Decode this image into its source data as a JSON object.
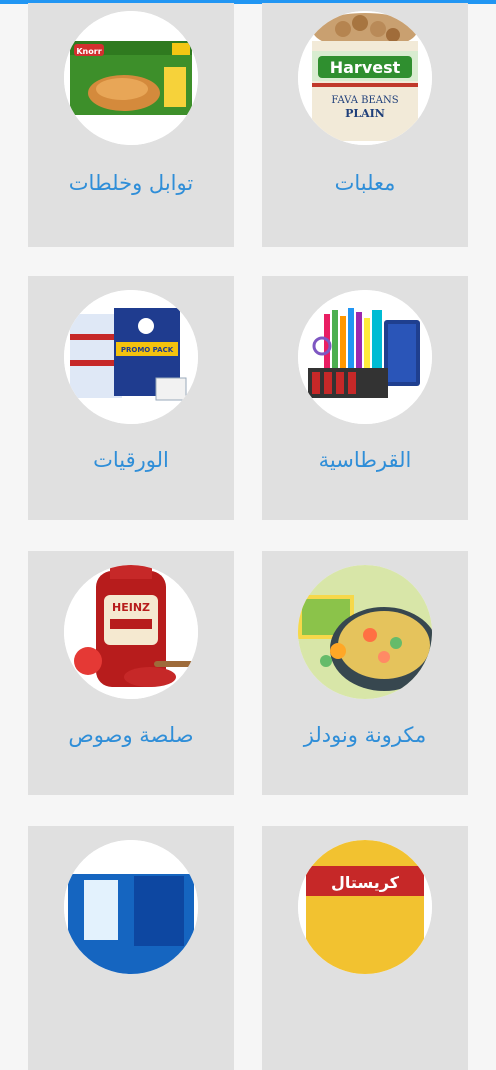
{
  "accent_color": "#2196f3",
  "label_color": "#2f8ed8",
  "card_color": "#e0e0e0",
  "categories": [
    {
      "label": "معلبات",
      "icon": "canned-food-image"
    },
    {
      "label": "توابل وخلطات",
      "icon": "spices-mixes-image"
    },
    {
      "label": "القرطاسية",
      "icon": "stationery-image"
    },
    {
      "label": "الورقيات",
      "icon": "paper-products-image"
    },
    {
      "label": "مكرونة ونودلز",
      "icon": "pasta-noodles-image"
    },
    {
      "label": "صلصة وصوص",
      "icon": "sauces-image"
    },
    {
      "label": "",
      "icon": "crystal-oil-image"
    },
    {
      "label": "",
      "icon": "dairy-image"
    }
  ],
  "product_texts": {
    "harvest_brand": "Harvest",
    "fava_beans": "FAVA BEANS",
    "plain": "PLAIN",
    "knorr_brand": "Knorr",
    "promo_pack": "PROMO PACK",
    "heinz_brand": "HEINZ",
    "crystal_brand": "كريستال"
  }
}
